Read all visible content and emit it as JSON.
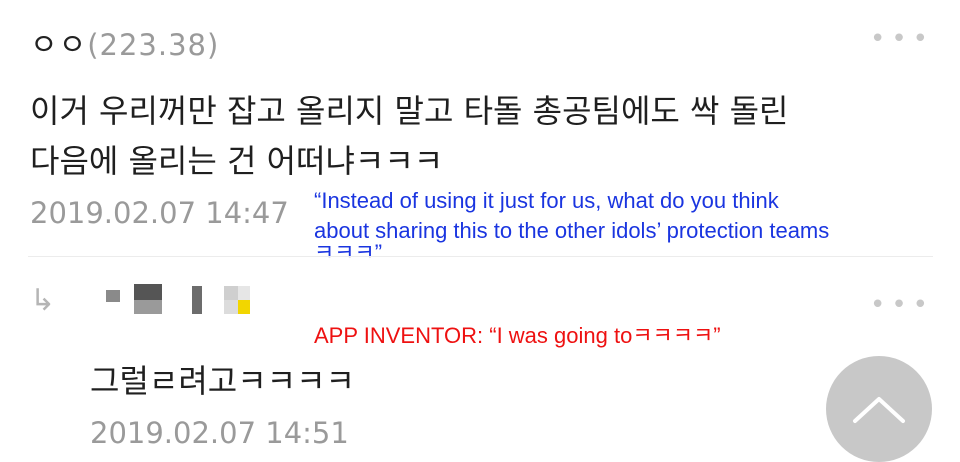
{
  "post": {
    "author": "ㅇㅇ",
    "ip": "(223.38)",
    "text_line1": "이거 우리꺼만 잡고 올리지 말고 타돌 총공팀에도 싹 돌린",
    "text_line2": "다음에 올리는 건 어떠냐ㅋㅋㅋ",
    "timestamp": "2019.02.07 14:47",
    "more_icon": "more-dots-icon"
  },
  "translation_blue": {
    "line1": "“Instead of using it just for us, what do you think",
    "line2": "about sharing this to the other idols’ protection teams",
    "line3": "ㅋㅋㅋ”",
    "color": "#1a35e0"
  },
  "reply": {
    "arrow_icon": "reply-arrow-icon",
    "text": "그럴ㄹ려고ㅋㅋㅋㅋ",
    "timestamp": "2019.02.07 14:51"
  },
  "translation_red": {
    "text": "APP INVENTOR: “I was going toㅋㅋㅋㅋ”",
    "color": "#ee1111"
  },
  "scroll_top": {
    "icon": "chevron-up-icon",
    "color": "#c8c8c8"
  }
}
